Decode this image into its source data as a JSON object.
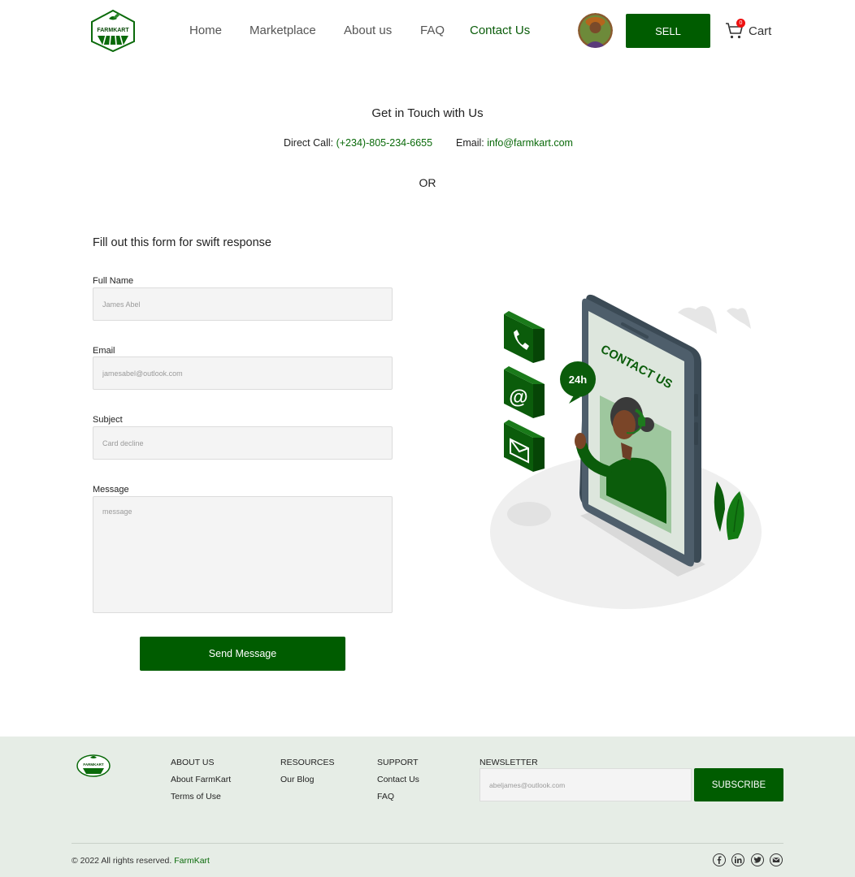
{
  "header": {
    "logo_text": "FARMKART",
    "nav": [
      "Home",
      "Marketplace",
      "About us",
      "FAQ",
      "Contact Us"
    ],
    "active_nav": "Contact Us",
    "sell_label": "SELL",
    "cart_label": "Cart",
    "cart_count": "0"
  },
  "contact": {
    "title": "Get in Touch with Us",
    "direct_call_label": "Direct Call: ",
    "direct_call_value": "(+234)-805-234-6655",
    "email_label": "Email: ",
    "email_value": "info@farmkart.com",
    "or_label": "OR"
  },
  "form": {
    "title": "Fill out this form for swift response",
    "full_name_label": "Full Name",
    "full_name_placeholder": "James Abel",
    "email_label": "Email",
    "email_placeholder": "jamesabel@outlook.com",
    "subject_label": "Subject",
    "subject_placeholder": "Card decline",
    "message_label": "Message",
    "message_placeholder": "message",
    "send_label": "Send Message"
  },
  "illustration": {
    "sign_text": "CONTACT US",
    "badge_text": "24h"
  },
  "footer": {
    "logo_text": "FARMKART",
    "about": {
      "title": "ABOUT US",
      "links": [
        "About FarmKart",
        "Terms of Use"
      ]
    },
    "resources": {
      "title": "RESOURCES",
      "links": [
        "Our Blog"
      ]
    },
    "support": {
      "title": "SUPPORT",
      "links": [
        "Contact Us",
        "FAQ"
      ]
    },
    "newsletter": {
      "title": "NEWSLETTER",
      "placeholder": "abeljames@outlook.com",
      "button": "SUBSCRIBE"
    },
    "copyright_prefix": "© 2022 All rights reserved. ",
    "copyright_brand": "FarmKart",
    "social_icons": [
      "facebook-icon",
      "linkedin-icon",
      "twitter-icon",
      "mail-icon"
    ]
  },
  "colors": {
    "brand_green": "#005c00",
    "link_green": "#0a6a0a",
    "footer_bg": "#e6ede6",
    "field_bg": "#f4f4f4",
    "badge_red": "#e11111"
  }
}
